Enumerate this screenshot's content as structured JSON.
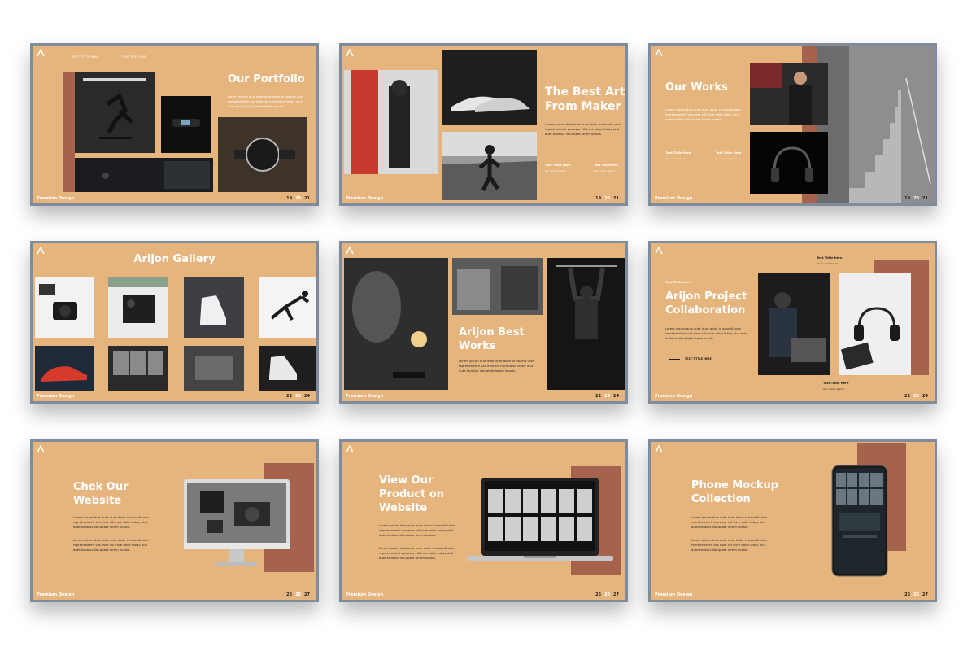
{
  "common": {
    "brand": "Premium Design",
    "lorem": "Lorem ipsum duis aute irure dolor in bouelit ulue reprehenderit vos esse cill irure dolor laboy ulut aute kudalus Voluptate lorem kusais."
  },
  "slides": [
    {
      "title": "Our Portfolio",
      "top_labels": [
        "TEXT TITTLE HERE",
        "TEXT TITLE HERE"
      ],
      "pages": [
        "19",
        "20",
        "21"
      ],
      "current": 1
    },
    {
      "title_lines": [
        "The Best Art",
        "From Maker"
      ],
      "labels": [
        {
          "title": "Text Tittle Here",
          "sub": "Our Lorem Ipsum"
        },
        {
          "title": "Text Tittlehere",
          "sub": "Our Lorem Ipsum"
        }
      ],
      "pages": [
        "19",
        "20",
        "21"
      ],
      "current": 1
    },
    {
      "title": "Our Works",
      "labels": [
        {
          "title": "Text Tittle Here",
          "sub": "Our Lorem Ipsum"
        },
        {
          "title": "Text Tittle Here",
          "sub": "Our Lorem Ipsum"
        }
      ],
      "pages": [
        "19",
        "20",
        "21"
      ],
      "current": 1
    },
    {
      "title": "Arijon Gallery",
      "pages": [
        "22",
        "23",
        "24"
      ],
      "current": 1
    },
    {
      "title_lines": [
        "Arijon Best",
        "Works"
      ],
      "pages": [
        "22",
        "23",
        "24"
      ],
      "current": 1
    },
    {
      "kicker": "Text Tittle Here",
      "title_lines": [
        "Arijon Project",
        "Collaboration"
      ],
      "line_label": "TEXT TITTLE HERE",
      "labels": [
        {
          "title": "Text Tittle Here",
          "sub": "Our Lorem Ipsum"
        },
        {
          "title": "Text Tittle Here",
          "sub": "Our Lorem Ipsum"
        }
      ],
      "pages": [
        "22",
        "23",
        "24"
      ],
      "current": 1
    },
    {
      "title_lines": [
        "Chek Our",
        "Website"
      ],
      "pages": [
        "25",
        "26",
        "27"
      ],
      "current": 1
    },
    {
      "title_lines": [
        "View Our",
        "Product on",
        "Website"
      ],
      "pages": [
        "25",
        "26",
        "27"
      ],
      "current": 1
    },
    {
      "title_lines": [
        "Phone Mockup",
        "Collection"
      ],
      "pages": [
        "25",
        "26",
        "27"
      ],
      "current": 1
    }
  ]
}
